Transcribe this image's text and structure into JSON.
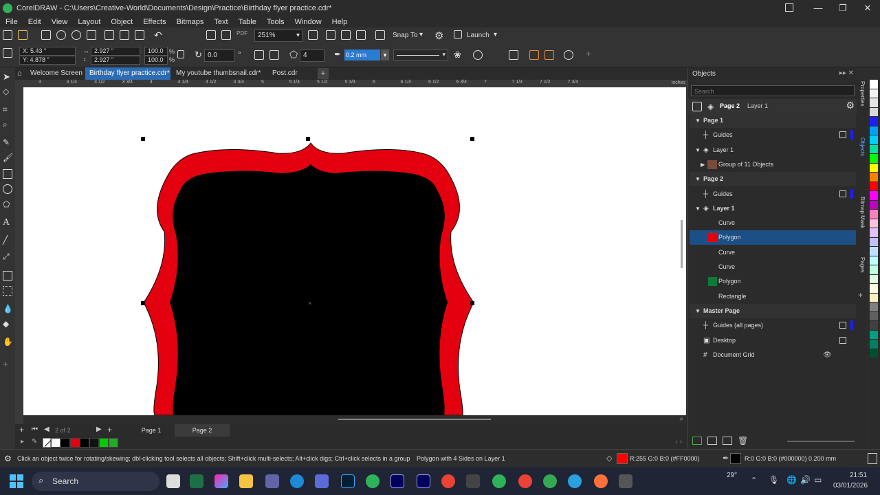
{
  "window": {
    "title": "CorelDRAW - C:\\Users\\Creative-World\\Documents\\Design\\Practice\\Birthday flyer practice.cdr*",
    "controls": [
      "—",
      "❐",
      "✕"
    ]
  },
  "menu": [
    "File",
    "Edit",
    "View",
    "Layout",
    "Object",
    "Effects",
    "Bitmaps",
    "Text",
    "Table",
    "Tools",
    "Window",
    "Help"
  ],
  "toolbar1": {
    "zoom": "251%",
    "snap_to": "Snap To",
    "launch": "Launch"
  },
  "propertybar": {
    "x": "X: 5.43 \"",
    "y": "Y: 4.878 \"",
    "width": "2.927 \"",
    "height": "2.927 \"",
    "scale_w": "100.0",
    "scale_h": "100.0",
    "pct": "%",
    "rotation": "0.0",
    "sides": "4",
    "outline_width": "0.2 mm"
  },
  "tabs": [
    {
      "label": "Welcome Screen",
      "active": false
    },
    {
      "label": "Birthday flyer practice.cdr*",
      "active": true
    },
    {
      "label": "My youtube thumbsnail.cdr*",
      "active": false
    },
    {
      "label": "Post.cdr",
      "active": false
    }
  ],
  "ruler": {
    "unit": "inches",
    "ticks": [
      "3",
      "3 1/4",
      "3 1/2",
      "3 3/4",
      "4",
      "4 1/4",
      "4 1/2",
      "4 3/4",
      "5",
      "5 1/4",
      "5 1/2",
      "5 3/4",
      "6",
      "6 1/4",
      "6 1/2",
      "6 3/4",
      "7",
      "7 1/4",
      "7 1/2",
      "7 3/4"
    ]
  },
  "pages": {
    "current": "2",
    "of": "of",
    "total": "2",
    "page1": "Page 1",
    "page2": "Page 2"
  },
  "docker": {
    "title": "Objects",
    "search_placeholder": "Search",
    "current_page": "Page 2",
    "current_layer": "Layer 1",
    "rows": [
      {
        "label": "Page 1",
        "indent": 0,
        "kind": "page",
        "icon": "chevron-down-icon"
      },
      {
        "label": "Guides",
        "indent": 1,
        "kind": "guides",
        "icon": "guides-icon"
      },
      {
        "label": "Layer 1",
        "indent": 1,
        "kind": "layer",
        "icon": "layer-icon"
      },
      {
        "label": "Group of 11 Objects",
        "indent": 2,
        "kind": "group",
        "icon": "thumbnail-icon"
      },
      {
        "label": "Page 2",
        "indent": 0,
        "kind": "page",
        "icon": "chevron-down-icon"
      },
      {
        "label": "Guides",
        "indent": 1,
        "kind": "guides",
        "icon": "guides-icon"
      },
      {
        "label": "Layer 1",
        "indent": 1,
        "kind": "layer",
        "icon": "layer-icon"
      },
      {
        "label": "Curve",
        "indent": 2,
        "kind": "object",
        "swatch": ""
      },
      {
        "label": "Polygon",
        "indent": 2,
        "kind": "object",
        "swatch": "#e3000f",
        "selected": true
      },
      {
        "label": "Curve",
        "indent": 2,
        "kind": "object",
        "swatch": ""
      },
      {
        "label": "Curve",
        "indent": 2,
        "kind": "object",
        "swatch": ""
      },
      {
        "label": "Polygon",
        "indent": 2,
        "kind": "object",
        "swatch": "#0e7a3a"
      },
      {
        "label": "Rectangle",
        "indent": 2,
        "kind": "object",
        "swatch": ""
      },
      {
        "label": "Master Page",
        "indent": 0,
        "kind": "page",
        "icon": "chevron-down-icon"
      },
      {
        "label": "Guides (all pages)",
        "indent": 1,
        "kind": "guides",
        "icon": "guides-icon"
      },
      {
        "label": "Desktop",
        "indent": 1,
        "kind": "desktop",
        "icon": "desktop-icon"
      },
      {
        "label": "Document Grid",
        "indent": 1,
        "kind": "grid",
        "icon": "grid-icon"
      }
    ]
  },
  "dockertabs": [
    "Properties",
    "Objects",
    "Bitmap Mask",
    "Pages"
  ],
  "palette_colors": [
    "#ffffff",
    "#000000",
    "#e3000f",
    "#000000",
    "#111111",
    "#00cc00",
    "#22aa22"
  ],
  "right_palette": [
    "#ffffff",
    "#f2f2f2",
    "#e6e6e6",
    "#d9d9d9",
    "#1d1dff",
    "#00a0ff",
    "#00d0ff",
    "#00e0a0",
    "#00ff00",
    "#ffff00",
    "#ff8000",
    "#ff0000",
    "#ff00ff",
    "#c000c0",
    "#ff80c0",
    "#ffc0e0",
    "#e0c0ff",
    "#c0c0ff",
    "#c0e0ff",
    "#c0ffff",
    "#c0ffe0",
    "#e0ffe0",
    "#ffffe0",
    "#fff0c0",
    "#808080",
    "#606060",
    "#404040",
    "#00a080",
    "#008060",
    "#005030"
  ],
  "status": {
    "hint": "Click an object twice for rotating/skewing; dbl-clicking tool selects all objects; Shift+click multi-selects; Alt+click digs; Ctrl+click selects in a group",
    "selection": "Polygon with 4 Sides on Layer 1",
    "fill": "R:255 G:0 B:0 (#FF0000)",
    "fill_color": "#ff0000",
    "outline": "R:0 G:0 B:0 (#000000)  0.200 mm",
    "outline_color": "#000000"
  },
  "taskbar": {
    "search": "Search",
    "weather": "29°",
    "time": "21:51",
    "date": "03/01/2026"
  }
}
